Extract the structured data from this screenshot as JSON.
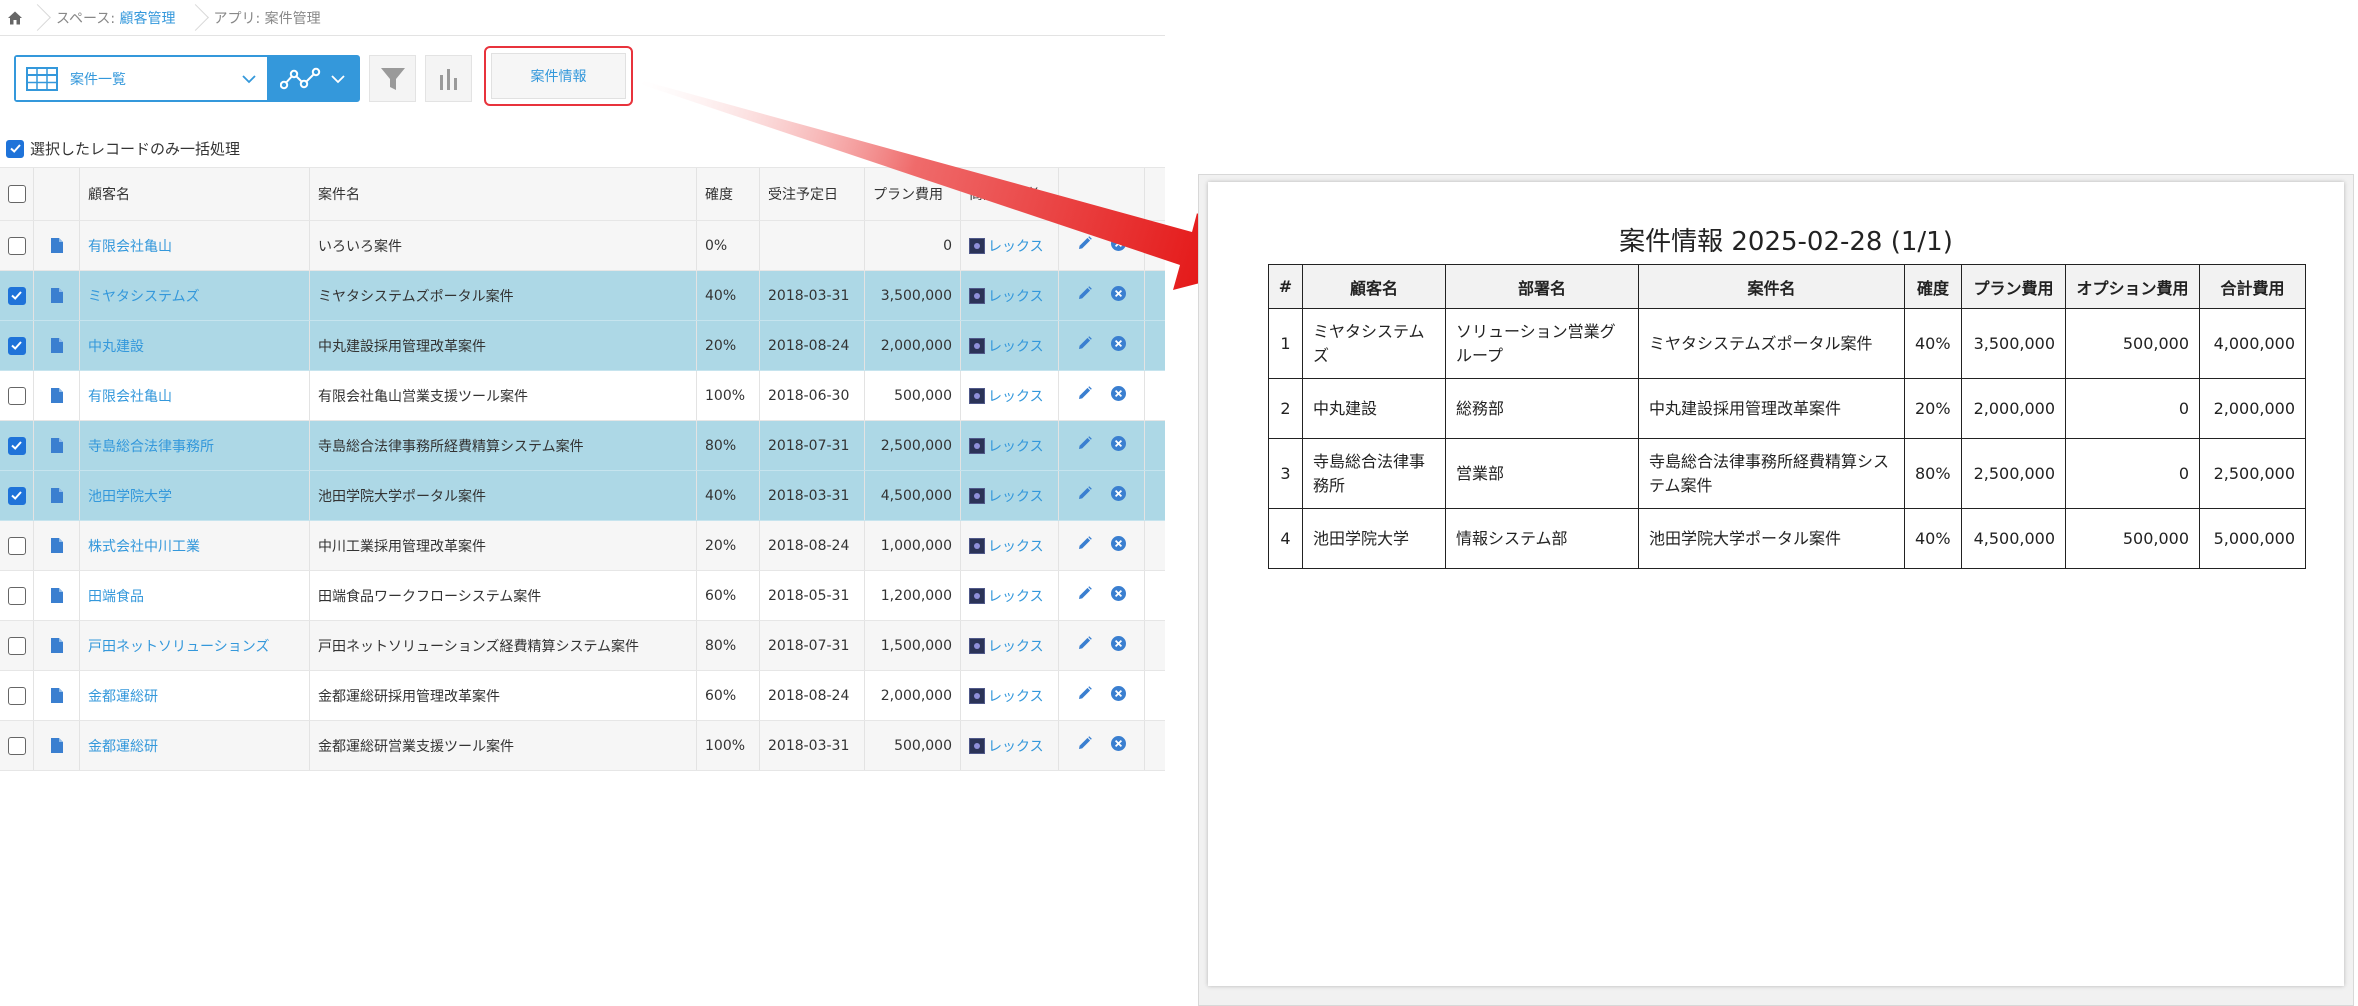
{
  "breadcrumb": {
    "space_prefix": "スペース: ",
    "space_name": "顧客管理",
    "app_label": "アプリ: 案件管理"
  },
  "toolbar": {
    "view_name": "案件一覧",
    "custom_button_label": "案件情報"
  },
  "bulk_label": "選択したレコードのみ一括処理",
  "records": {
    "headers": {
      "customer": "顧客名",
      "case": "案件名",
      "probability": "確度",
      "order_date": "受注予定日",
      "plan_fee": "プラン費用",
      "staff": "商談担当者"
    },
    "rows": [
      {
        "checked": false,
        "customer": "有限会社亀山",
        "case": "いろいろ案件",
        "probability": "0%",
        "order_date": "",
        "plan_fee": "0",
        "staff": "レックス"
      },
      {
        "checked": true,
        "customer": "ミヤタシステムズ",
        "case": "ミヤタシステムズポータル案件",
        "probability": "40%",
        "order_date": "2018-03-31",
        "plan_fee": "3,500,000",
        "staff": "レックス"
      },
      {
        "checked": true,
        "customer": "中丸建設",
        "case": "中丸建設採用管理改革案件",
        "probability": "20%",
        "order_date": "2018-08-24",
        "plan_fee": "2,000,000",
        "staff": "レックス"
      },
      {
        "checked": false,
        "customer": "有限会社亀山",
        "case": "有限会社亀山営業支援ツール案件",
        "probability": "100%",
        "order_date": "2018-06-30",
        "plan_fee": "500,000",
        "staff": "レックス"
      },
      {
        "checked": true,
        "customer": "寺島総合法律事務所",
        "case": "寺島総合法律事務所経費精算システム案件",
        "probability": "80%",
        "order_date": "2018-07-31",
        "plan_fee": "2,500,000",
        "staff": "レックス"
      },
      {
        "checked": true,
        "customer": "池田学院大学",
        "case": "池田学院大学ポータル案件",
        "probability": "40%",
        "order_date": "2018-03-31",
        "plan_fee": "4,500,000",
        "staff": "レックス"
      },
      {
        "checked": false,
        "customer": "株式会社中川工業",
        "case": "中川工業採用管理改革案件",
        "probability": "20%",
        "order_date": "2018-08-24",
        "plan_fee": "1,000,000",
        "staff": "レックス"
      },
      {
        "checked": false,
        "customer": "田端食品",
        "case": "田端食品ワークフローシステム案件",
        "probability": "60%",
        "order_date": "2018-05-31",
        "plan_fee": "1,200,000",
        "staff": "レックス"
      },
      {
        "checked": false,
        "customer": "戸田ネットソリューションズ",
        "case": "戸田ネットソリューションズ経費精算システム案件",
        "probability": "80%",
        "order_date": "2018-07-31",
        "plan_fee": "1,500,000",
        "staff": "レックス"
      },
      {
        "checked": false,
        "customer": "金都運総研",
        "case": "金都運総研採用管理改革案件",
        "probability": "60%",
        "order_date": "2018-08-24",
        "plan_fee": "2,000,000",
        "staff": "レックス"
      },
      {
        "checked": false,
        "customer": "金都運総研",
        "case": "金都運総研営業支援ツール案件",
        "probability": "100%",
        "order_date": "2018-03-31",
        "plan_fee": "500,000",
        "staff": "レックス"
      }
    ]
  },
  "report": {
    "title": "案件情報 2025-02-28 (1/1)",
    "headers": {
      "index": "#",
      "customer": "顧客名",
      "department": "部署名",
      "case": "案件名",
      "probability": "確度",
      "plan_fee": "プラン費用",
      "option_fee": "オプション費用",
      "total_fee": "合計費用"
    },
    "rows": [
      {
        "index": "1",
        "customer": "ミヤタシステムズ",
        "department": "ソリューション営業グループ",
        "case": "ミヤタシステムズポータル案件",
        "probability": "40%",
        "plan_fee": "3,500,000",
        "option_fee": "500,000",
        "total_fee": "4,000,000"
      },
      {
        "index": "2",
        "customer": "中丸建設",
        "department": "総務部",
        "case": "中丸建設採用管理改革案件",
        "probability": "20%",
        "plan_fee": "2,000,000",
        "option_fee": "0",
        "total_fee": "2,000,000"
      },
      {
        "index": "3",
        "customer": "寺島総合法律事務所",
        "department": "営業部",
        "case": "寺島総合法律事務所経費精算システム案件",
        "probability": "80%",
        "plan_fee": "2,500,000",
        "option_fee": "0",
        "total_fee": "2,500,000"
      },
      {
        "index": "4",
        "customer": "池田学院大学",
        "department": "情報システム部",
        "case": "池田学院大学ポータル案件",
        "probability": "40%",
        "plan_fee": "4,500,000",
        "option_fee": "500,000",
        "total_fee": "5,000,000"
      }
    ]
  },
  "colors": {
    "accent": "#3498db",
    "selected_row": "#add8e6",
    "highlight_red": "#e8333c"
  }
}
